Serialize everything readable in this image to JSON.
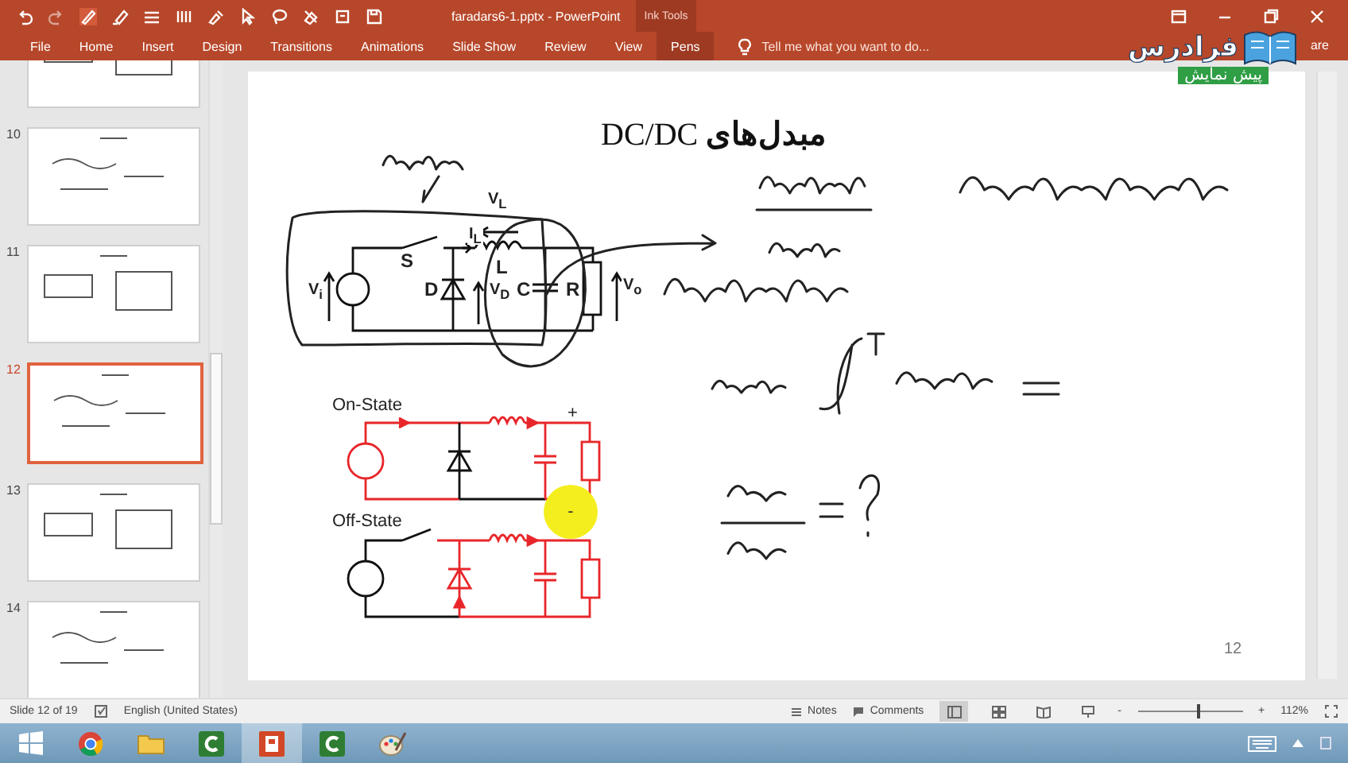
{
  "title_bar": {
    "title": "faradars6-1.pptx - PowerPoint",
    "context_label": "Ink Tools"
  },
  "ribbon_tabs": [
    {
      "label": "File",
      "selected": false
    },
    {
      "label": "Home",
      "selected": false
    },
    {
      "label": "Insert",
      "selected": false
    },
    {
      "label": "Design",
      "selected": false
    },
    {
      "label": "Transitions",
      "selected": false
    },
    {
      "label": "Animations",
      "selected": false
    },
    {
      "label": "Slide Show",
      "selected": false
    },
    {
      "label": "Review",
      "selected": false
    },
    {
      "label": "View",
      "selected": false
    },
    {
      "label": "Pens",
      "selected": true
    }
  ],
  "tell_me": {
    "placeholder": "Tell me what you want to do..."
  },
  "share_fragment": "are",
  "logo": {
    "name": "فرادرس",
    "badge": "پیش نمایش"
  },
  "thumbnails": [
    {
      "selected": false
    },
    {
      "number": "10",
      "selected": false
    },
    {
      "number": "11",
      "selected": false
    },
    {
      "number": "12",
      "selected": true
    },
    {
      "number": "13",
      "selected": false
    },
    {
      "number": "14",
      "selected": false
    }
  ],
  "slide": {
    "title": "**مبدل‌های** DC/DC",
    "number": "12",
    "circuit_labels": [
      "V$_{L}$",
      "I$_{L}$",
      "S",
      "L",
      "V$_{i}$",
      "D",
      "V$_{D}$",
      "C",
      "R",
      "V$_{o}$"
    ],
    "on_state": {
      "label": "On-State",
      "plus": "+",
      "minus": "-"
    },
    "off_state": {
      "label": "Off-State"
    }
  },
  "status_bar": {
    "slide_info": "Slide 12 of 19",
    "language": "English (United States)",
    "notes": "Notes",
    "comments": "Comments",
    "zoom_out": "-",
    "zoom_in": "+",
    "zoom": {
      "level": 0.57,
      "reading": "112%"
    }
  },
  "taskbar": {
    "apps": [
      {
        "kind": "browser",
        "active": false
      },
      {
        "kind": "folder",
        "active": false
      },
      {
        "kind": "recorder",
        "active": false
      },
      {
        "kind": "presentation",
        "active": true
      },
      {
        "kind": "recorder",
        "active": false
      },
      {
        "kind": "paint",
        "active": false
      }
    ]
  }
}
